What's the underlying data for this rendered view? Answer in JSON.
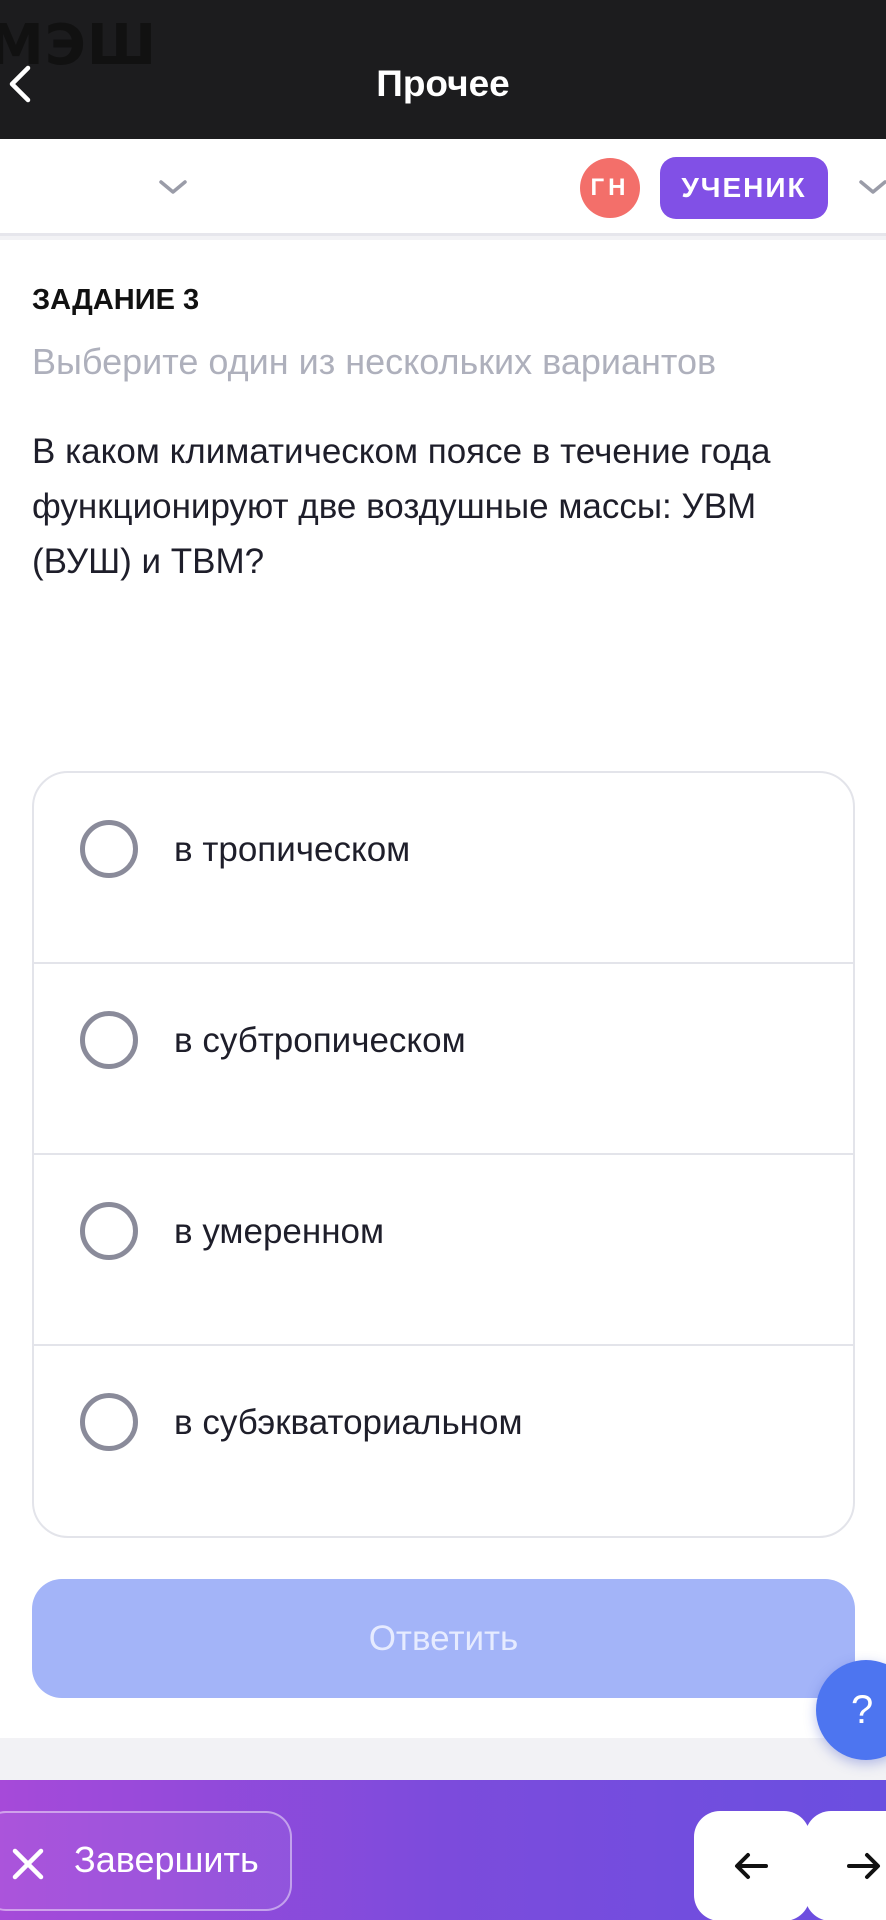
{
  "topbar": {
    "title": "Прочее",
    "back_icon": "chevron-left-icon"
  },
  "header": {
    "logo": "МЭШ",
    "avatar_initials": "ГН",
    "role": "УЧЕНИК",
    "colors": {
      "avatar": "#f36f6a",
      "role_badge": "#8150e6"
    }
  },
  "task": {
    "title": "ЗАДАНИЕ 3",
    "subtitle": "Выберите один из нескольких вариантов",
    "question": "В каком климатическом поясе в течение года функционируют две воздушные массы: УВМ (ВУШ) и ТВМ?",
    "options": [
      {
        "label": "в тропическом",
        "selected": false
      },
      {
        "label": "в субтропическом",
        "selected": false
      },
      {
        "label": "в умеренном",
        "selected": false
      },
      {
        "label": "в субэкваториальном",
        "selected": false
      }
    ],
    "submit_label": "Ответить"
  },
  "help": {
    "label": "?"
  },
  "footer": {
    "finish_label": "Завершить",
    "prev_icon": "arrow-left-icon",
    "next_icon": "arrow-right-icon"
  }
}
